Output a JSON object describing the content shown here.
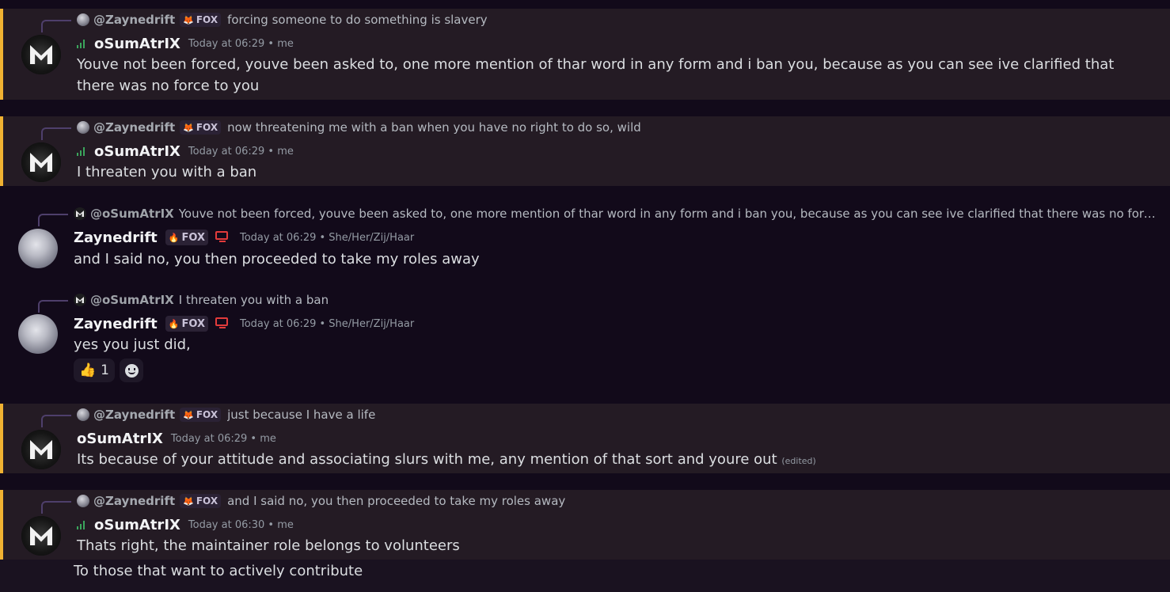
{
  "fox_tag": "FOX",
  "me_suffix": " • me",
  "pronouns_suffix": " • She/Her/Zij/Haar",
  "messages": [
    {
      "reply_name": "@Zaynedrift",
      "reply_text": "forcing someone to do something is slavery",
      "author": "oSumAtrIX",
      "time": "Today at 06:29",
      "text": "Youve not been forced, youve been asked to, one more mention of thar word in any form and i ban you, because as you can see ive clarified that there was no force to you"
    },
    {
      "reply_name": "@Zaynedrift",
      "reply_text": "now threatening me with a ban when you have no right to do so, wild",
      "author": "oSumAtrIX",
      "time": "Today at 06:29",
      "text": "I threaten you with a ban"
    },
    {
      "reply_name": "@oSumAtrIX",
      "reply_text": "Youve not been forced, youve been asked to, one more mention of thar word in any form and i ban you, because as you can see ive clarified that there was no force to...",
      "author": "Zaynedrift",
      "time": "Today at 06:29",
      "text": "and I said no, you then proceeded to take my roles away"
    },
    {
      "reply_name": "@oSumAtrIX",
      "reply_text": "I threaten you with a ban",
      "author": "Zaynedrift",
      "time": "Today at 06:29",
      "text": "yes you just did,",
      "reaction_emoji": "👍",
      "reaction_count": "1"
    },
    {
      "reply_name": "@Zaynedrift",
      "reply_text": "just because I have a life",
      "author": "oSumAtrIX",
      "time": "Today at 06:29",
      "text": "Its because of your attitude and associating slurs with me, any mention of that sort and youre out",
      "edited": "(edited)"
    },
    {
      "reply_name": "@Zaynedrift",
      "reply_text": "and I said no, you then proceeded to take my roles away",
      "author": "oSumAtrIX",
      "time": "Today at 06:30",
      "text": "Thats right, the maintainer role belongs to volunteers",
      "followup": "To those that want to actively contribute"
    }
  ],
  "colors": {
    "background": "#120a1a",
    "mention_highlight": "#241b24",
    "mention_bar": "#f0b232",
    "status_bars": "#3ba55c",
    "device_icon": "#e23b3b"
  }
}
